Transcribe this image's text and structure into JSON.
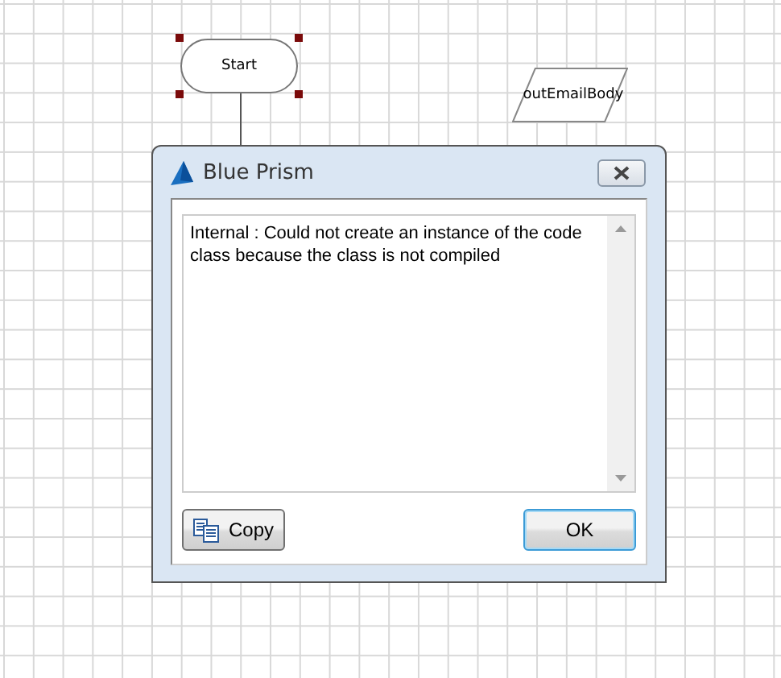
{
  "canvas": {
    "nodes": [
      {
        "kind": "terminal",
        "label": "Start",
        "selected": true
      },
      {
        "kind": "data",
        "label": "outEmailBody",
        "selected": false
      }
    ]
  },
  "dialog": {
    "title": "Blue Prism",
    "message": "Internal : Could not create an instance of the code class because the class is not compiled",
    "buttons": [
      {
        "kind": "copy",
        "label": "Copy",
        "default": false
      },
      {
        "kind": "plain",
        "label": "OK",
        "default": true
      }
    ]
  }
}
